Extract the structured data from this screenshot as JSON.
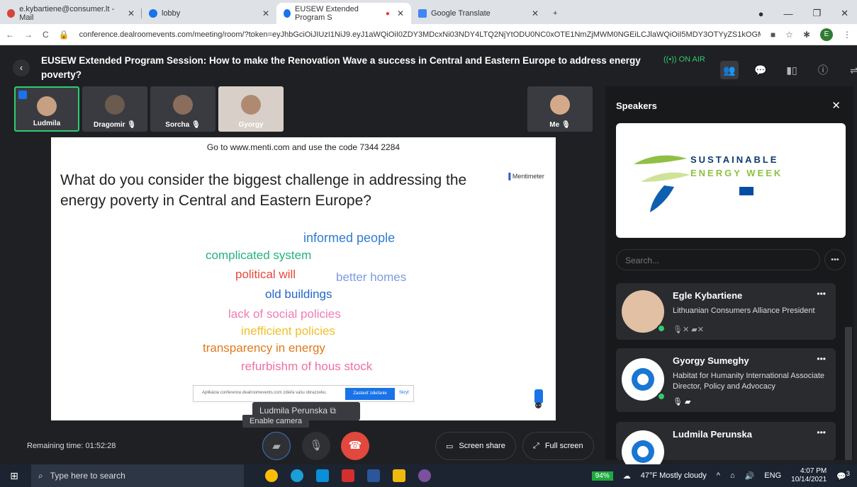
{
  "browser": {
    "tabs": [
      {
        "label": "e.kybartiene@consumer.lt - Mail",
        "color": "#d44638"
      },
      {
        "label": "lobby",
        "color": "#1a73e8"
      },
      {
        "label": "EUSEW Extended Program S",
        "color": "#1a73e8"
      },
      {
        "label": "Google Translate",
        "color": "#4285f4"
      }
    ],
    "url": "conference.dealroomevents.com/meeting/room/?token=eyJhbGciOiJIUzI1NiJ9.eyJ1aWQiOiI0ZDY3MDcxNi03NDY4LTQ2NjYtODU0NC0xOTE1NmZjMWM0NGEiLCJlaWQiOiI5MDY3OTYyZS1kOGM0L...",
    "profile_initial": "E"
  },
  "session": {
    "title": "EUSEW Extended Program Session: How to make the Renovation Wave a success in Central and Eastern Europe to address energy poverty?",
    "on_air": "ON AIR"
  },
  "participants": [
    {
      "name": "Ludmila"
    },
    {
      "name": "Dragomir"
    },
    {
      "name": "Sorcha"
    },
    {
      "name": "Gyorgy"
    }
  ],
  "self_name": "Me",
  "slide": {
    "code_line": "Go to www.menti.com and use the code 7344 2284",
    "question": "What do you consider the biggest challenge in addressing the energy poverty in Central and Eastern Europe?",
    "brand": "Mentimeter",
    "words": [
      {
        "text": "informed people",
        "color": "#2f7bd1"
      },
      {
        "text": "complicated system",
        "color": "#23b37a"
      },
      {
        "text": "political will",
        "color": "#e8473a"
      },
      {
        "text": "better homes",
        "color": "#7d9be0"
      },
      {
        "text": "old buildings",
        "color": "#2168c9"
      },
      {
        "text": "lack of social policies",
        "color": "#f07bb5"
      },
      {
        "text": "inefficient policies",
        "color": "#f0be2a"
      },
      {
        "text": "transparency in energy",
        "color": "#e07a1d"
      },
      {
        "text": "refurbishm of hous stock",
        "color": "#f06ea3"
      }
    ],
    "share_text": "Aplikácia conference.dealroomevents.com zdieľa vašu obrazovku.",
    "share_stop": "Zastaviť zdieľanie",
    "share_hide": "Skryť"
  },
  "presenter_label": "Ludmila Perunska",
  "tooltip": "Enable camera",
  "remaining": "Remaining time: 01:52:28",
  "controls": {
    "screen_share": "Screen share",
    "full_screen": "Full screen"
  },
  "panel": {
    "title": "Speakers",
    "banner_line1": "SUSTAINABLE",
    "banner_line2": "ENERGY WEEK",
    "search_placeholder": "Search...",
    "speakers": [
      {
        "name": "Egle Kybartiene",
        "role": "Lithuanian Consumers Alliance President"
      },
      {
        "name": "Gyorgy Sumeghy",
        "role": "Habitat for Humanity International Associate Director, Policy and Advocacy"
      },
      {
        "name": "Ludmila Perunska",
        "role": ""
      }
    ]
  },
  "taskbar": {
    "search_placeholder": "Type here to search",
    "battery": "94%",
    "weather": "47°F  Mostly cloudy",
    "lang": "ENG",
    "time": "4:07 PM",
    "date": "10/14/2021",
    "notif_count": "3"
  }
}
